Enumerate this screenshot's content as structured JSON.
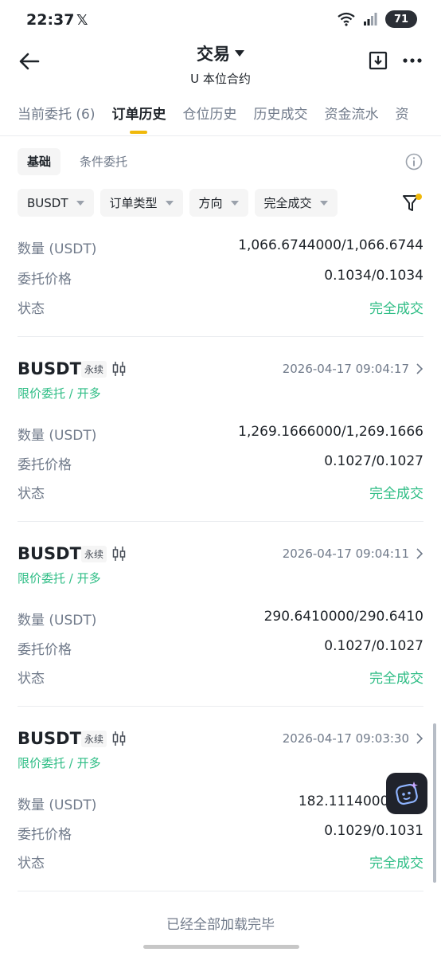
{
  "status": {
    "time": "22:37",
    "x_logo": "𝕏",
    "battery": "71"
  },
  "header": {
    "title": "交易",
    "subtitle": "U 本位合约"
  },
  "tabs": [
    {
      "label": "当前委托 (6)"
    },
    {
      "label": "订单历史"
    },
    {
      "label": "仓位历史"
    },
    {
      "label": "历史成交"
    },
    {
      "label": "资金流水"
    },
    {
      "label": "资"
    }
  ],
  "subtabs": [
    {
      "label": "基础"
    },
    {
      "label": "条件委托"
    }
  ],
  "filters": [
    {
      "label": "BUSDT"
    },
    {
      "label": "订单类型"
    },
    {
      "label": "方向"
    },
    {
      "label": "完全成交"
    }
  ],
  "labels": {
    "qty": "数量 (USDT)",
    "price": "委托价格",
    "status": "状态"
  },
  "top_partial": {
    "qty": "1,066.6744000/1,066.6744",
    "price": "0.1034/0.1034",
    "status": "完全成交"
  },
  "orders": [
    {
      "symbol": "BUSDT",
      "badge": "永续",
      "time": "2026-04-17 09:04:17",
      "type": "限价委托 / 开多",
      "qty": "1,269.1666000/1,269.1666",
      "price": "0.1027/0.1027",
      "status": "完全成交"
    },
    {
      "symbol": "BUSDT",
      "badge": "永续",
      "time": "2026-04-17 09:04:11",
      "type": "限价委托 / 开多",
      "qty": "290.6410000/290.6410",
      "price": "0.1027/0.1027",
      "status": "完全成交"
    },
    {
      "symbol": "BUSDT",
      "badge": "永续",
      "time": "2026-04-17 09:03:30",
      "type": "限价委托 / 开多",
      "qty": "182.1114000/182.",
      "price": "0.1029/0.1031",
      "status": "完全成交"
    }
  ],
  "footer": "已经全部加载完毕",
  "colors": {
    "accent": "#f0b90b",
    "green": "#2ebd85",
    "muted": "#707a8a"
  }
}
